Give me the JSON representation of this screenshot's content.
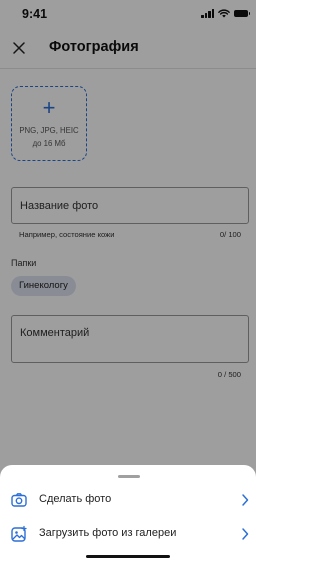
{
  "status_bar": {
    "time": "9:41",
    "icons": [
      "signal-icon",
      "wifi-icon",
      "battery-icon"
    ]
  },
  "header": {
    "title": "Фотография",
    "close_icon": "close-icon"
  },
  "upload": {
    "plus": "+",
    "formats": "PNG, JPG, HEIC",
    "max_size": "до 16 Мб"
  },
  "title_field": {
    "placeholder": "Название фото",
    "hint": "Например, состояние кожи",
    "counter": "0/ 100"
  },
  "folders": {
    "label": "Папки",
    "selected": "Гинекологу"
  },
  "comment_field": {
    "placeholder": "Комментарий",
    "counter": "0 / 500"
  },
  "sheet": {
    "items": [
      {
        "label": "Сделать фото",
        "icon": "camera-icon"
      },
      {
        "label": "Загрузить фото из галереи",
        "icon": "gallery-icon"
      }
    ]
  },
  "colors": {
    "accent": "#2d6fd6",
    "chip_bg": "#dde3ef",
    "overlay": "rgba(0,0,0,0.38)"
  }
}
